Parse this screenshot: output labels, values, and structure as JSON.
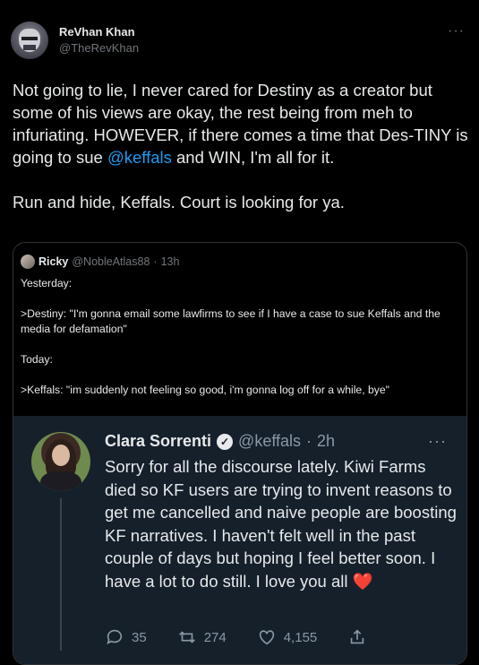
{
  "tweet": {
    "author_name": "ReVhan Khan",
    "author_handle": "@TheRevKhan",
    "more_icon": "more-icon",
    "text_part1": "Not going to lie, I never cared for Destiny as a creator but some of his views are okay, the rest being from meh to infuriating. HOWEVER, if there comes a time that Des-TINY is going to sue ",
    "mention": "@keffals",
    "text_part2": " and WIN, I'm all for it.\n\nRun and hide, Keffals. Court is looking for ya."
  },
  "quote": {
    "name": "Ricky",
    "handle": "@NobleAtlas88",
    "separator": "·",
    "time": "13h",
    "text": "Yesterday:\n\n>Destiny: \"I'm gonna email some lawfirms to see if I have a case to sue Keffals and the media for defamation\"\n\nToday:\n\n>Keffals: \"im suddenly not feeling so good, i'm gonna log off for a while, bye\""
  },
  "embedded": {
    "name": "Clara Sorrenti",
    "handle": "@keffals",
    "separator": "·",
    "time": "2h",
    "text": "Sorry for all the discourse lately. Kiwi Farms died so KF users are trying to invent reasons to get me cancelled and naive people are boosting KF narratives. I haven't felt well in the past couple of days but hoping I feel better soon. I have a lot to do still. I love you all",
    "emoji": "❤️",
    "replies": "35",
    "retweets": "274",
    "likes": "4,155"
  },
  "colors": {
    "background": "#000000",
    "text": "#e7e9ea",
    "secondary": "#71767b",
    "link": "#1d9bf0",
    "embedded_bg": "#15202b"
  }
}
